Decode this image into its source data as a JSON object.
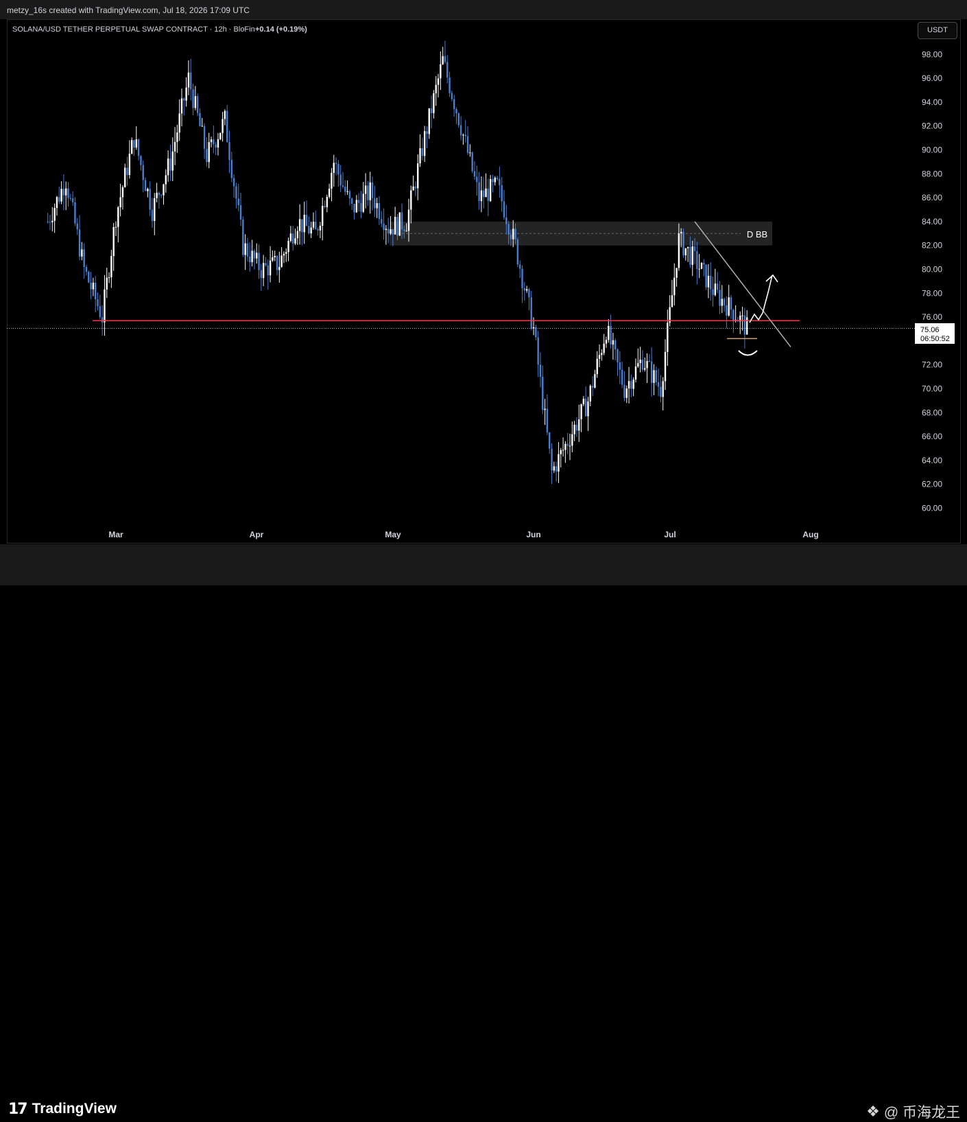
{
  "watermark": "metzy_16s created with TradingView.com, Jul 18, 2026 17:09 UTC",
  "header": {
    "symbol": "SOLANA/USD TETHER PERPETUAL SWAP CONTRACT · 12h · BloFin",
    "change": "+0.14 (+0.19%)"
  },
  "unit_button": "USDT",
  "annotations": {
    "zone_label": "D BB",
    "last_price": "75.06",
    "countdown": "06:50:52"
  },
  "footer": {
    "logo_mark": "17",
    "logo_text": "TradingView",
    "credit_text": "@ 币海龙王"
  },
  "colors": {
    "up": "#ffffff",
    "down": "#4a7fd0",
    "support_line": "#f23645",
    "zone": "#2a2a2a"
  },
  "chart_data": {
    "type": "candlestick",
    "title": "SOLANA/USD TETHER PERPETUAL SWAP CONTRACT · 12h · BloFin",
    "ylim": [
      58.5,
      100
    ],
    "y_ticks": [
      "98.00",
      "96.00",
      "94.00",
      "92.00",
      "90.00",
      "88.00",
      "86.00",
      "84.00",
      "82.00",
      "80.00",
      "78.00",
      "76.00",
      "74.00",
      "72.00",
      "70.00",
      "68.00",
      "66.00",
      "64.00",
      "62.00",
      "60.00"
    ],
    "x_ticks": [
      "Mar",
      "Apr",
      "May",
      "Jun",
      "Jul",
      "Aug"
    ],
    "close_series_approx": [
      [
        "Feb 14",
        84.0
      ],
      [
        "Feb 18",
        87.5
      ],
      [
        "Feb 22",
        80.0
      ],
      [
        "Feb 26",
        76.0
      ],
      [
        "Mar 1",
        84.5
      ],
      [
        "Mar 5",
        91.0
      ],
      [
        "Mar 9",
        85.0
      ],
      [
        "Mar 13",
        89.0
      ],
      [
        "Mar 17",
        96.0
      ],
      [
        "Mar 21",
        89.5
      ],
      [
        "Mar 25",
        92.5
      ],
      [
        "Mar 29",
        82.0
      ],
      [
        "Apr 2",
        80.0
      ],
      [
        "Apr 6",
        80.5
      ],
      [
        "Apr 10",
        84.0
      ],
      [
        "Apr 14",
        83.0
      ],
      [
        "Apr 18",
        89.0
      ],
      [
        "Apr 22",
        85.0
      ],
      [
        "Apr 26",
        86.5
      ],
      [
        "Apr 30",
        83.5
      ],
      [
        "May 4",
        84.0
      ],
      [
        "May 8",
        91.0
      ],
      [
        "May 12",
        97.5
      ],
      [
        "May 16",
        92.0
      ],
      [
        "May 20",
        86.0
      ],
      [
        "May 24",
        87.0
      ],
      [
        "May 28",
        82.0
      ],
      [
        "Jun 1",
        75.0
      ],
      [
        "Jun 5",
        63.0
      ],
      [
        "Jun 9",
        66.0
      ],
      [
        "Jun 13",
        69.0
      ],
      [
        "Jun 17",
        75.0
      ],
      [
        "Jun 21",
        70.0
      ],
      [
        "Jun 25",
        72.5
      ],
      [
        "Jun 29",
        70.0
      ],
      [
        "Jul 3",
        82.5
      ],
      [
        "Jul 7",
        80.5
      ],
      [
        "Jul 11",
        78.0
      ],
      [
        "Jul 15",
        76.5
      ],
      [
        "Jul 18",
        75.06
      ]
    ],
    "horizontal_lines": [
      {
        "price": 75.7,
        "color": "#f23645"
      }
    ],
    "zone": {
      "from": 82.0,
      "to": 84.0,
      "label": "D BB"
    },
    "last_price": 75.06
  }
}
